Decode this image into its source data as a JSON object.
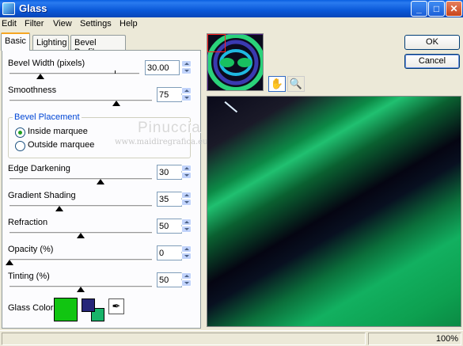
{
  "window": {
    "title": "Glass",
    "minimize": "_",
    "maximize": "□",
    "close": "✕"
  },
  "menu": [
    "Edit",
    "Filter",
    "View",
    "Settings",
    "Help"
  ],
  "tabs": [
    "Basic",
    "Lighting",
    "Bevel Profile"
  ],
  "basic": {
    "bevel_width": {
      "label": "Bevel Width (pixels)",
      "value": "30.00",
      "level": 0.24
    },
    "smoothness": {
      "label": "Smoothness",
      "value": "75",
      "level": 0.75
    },
    "bevel_placement": {
      "legend": "Bevel Placement",
      "options": [
        {
          "label": "Inside marquee",
          "checked": true
        },
        {
          "label": "Outside marquee",
          "checked": false
        }
      ]
    },
    "edge_darkening": {
      "label": "Edge Darkening",
      "value": "30",
      "level": 0.64
    },
    "gradient_shading": {
      "label": "Gradient Shading",
      "value": "35",
      "level": 0.35
    },
    "refraction": {
      "label": "Refraction",
      "value": "50",
      "level": 0.5
    },
    "opacity": {
      "label": "Opacity (%)",
      "value": "0",
      "level": 0.0
    },
    "tinting": {
      "label": "Tinting (%)",
      "value": "50",
      "level": 0.5
    },
    "glass_color": {
      "label": "Glass Color",
      "main": "#11c511",
      "fg": "#252578",
      "bg": "#18b46a"
    }
  },
  "buttons": {
    "ok": "OK",
    "cancel": "Cancel"
  },
  "tools": {
    "pan": "pan-hand-icon",
    "zoom": "zoom-magnifier-icon"
  },
  "watermark": {
    "name": "Pinuccia",
    "url": "www.maidiregrafica.eu"
  },
  "status": {
    "zoom": "100%"
  }
}
